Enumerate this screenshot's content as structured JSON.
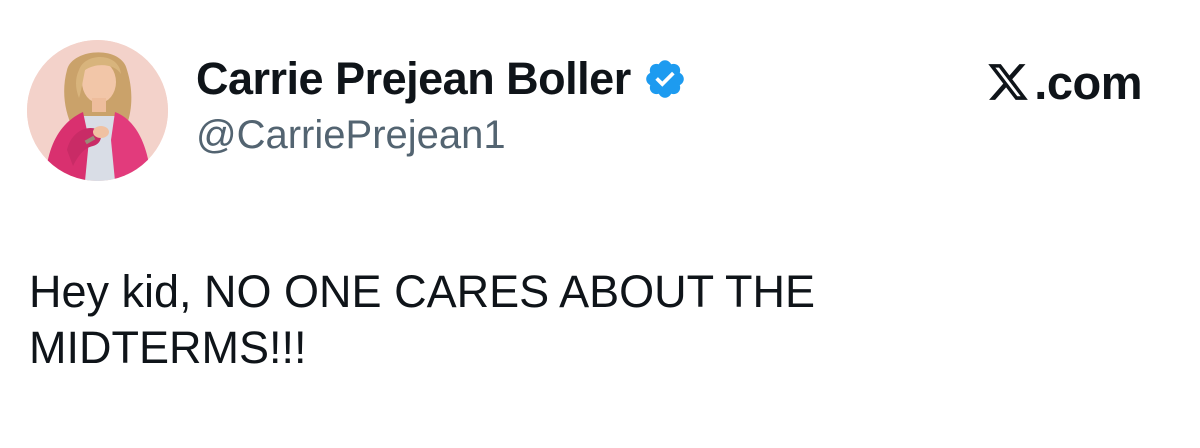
{
  "tweet": {
    "author": {
      "display_name": "Carrie Prejean Boller",
      "handle": "@CarriePrejean1",
      "verified_icon": "verified-badge-icon",
      "verified_color": "#1d9bf0"
    },
    "site": {
      "logo_icon": "x-logo-icon",
      "label": ".com"
    },
    "text_lines": [
      "Hey kid, NO ONE CARES ABOUT THE",
      "MIDTERMS!!!"
    ]
  }
}
